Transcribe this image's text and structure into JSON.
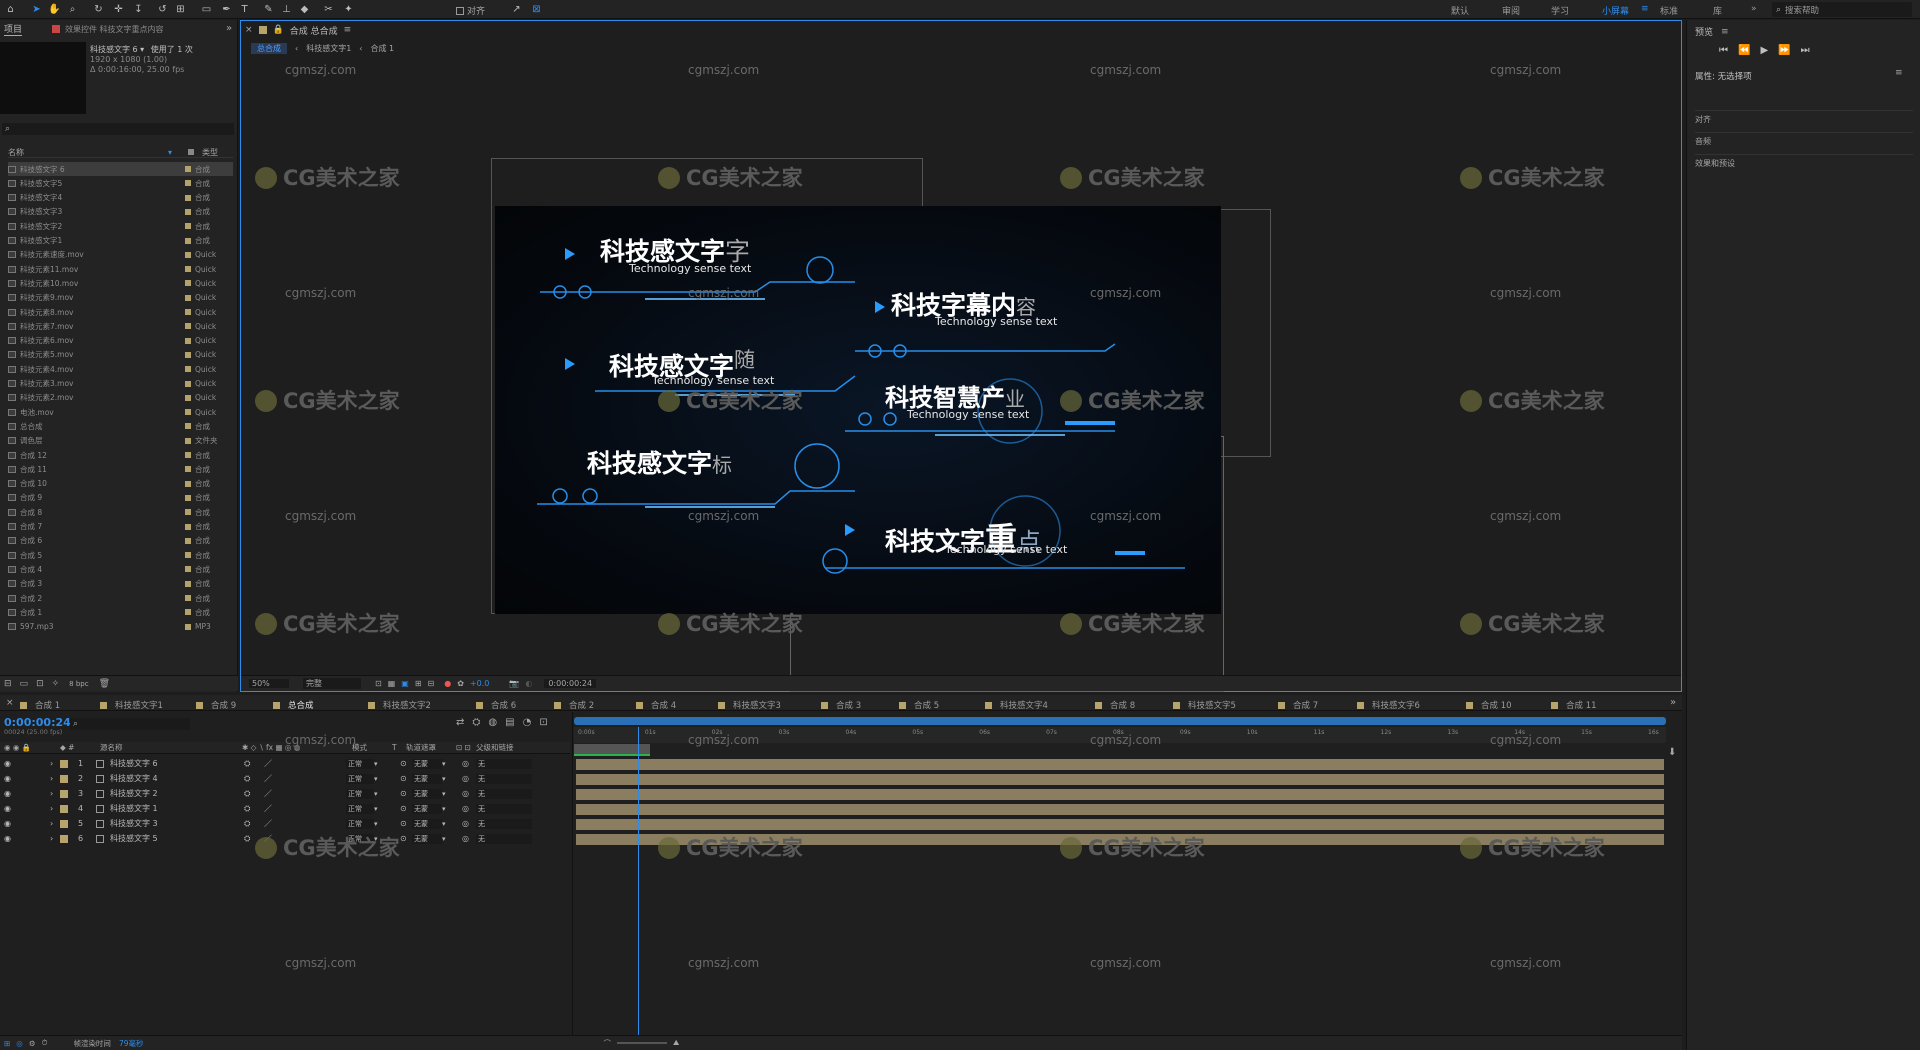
{
  "toolbar": {
    "align_label": "对齐",
    "workspaces": [
      "默认",
      "审阅",
      "学习",
      "小屏幕",
      "标准",
      "库"
    ],
    "search_placeholder": "搜索帮助",
    "active_color": "#2d8ceb"
  },
  "project": {
    "tab_label": "项目",
    "effect_tab": "效果控件 科技文字重点内容",
    "selected_name": "科技感文字 6 ▾",
    "selected_usage": "使用了 1 次",
    "selected_info1": "1920 x 1080 (1.00)",
    "selected_info2": "Δ 0:00:16:00, 25.00 fps",
    "col_name": "名称",
    "col_type": "类型",
    "items": [
      {
        "name": "科技感文字 6",
        "type": "合成"
      },
      {
        "name": "科技感文字5",
        "type": "合成"
      },
      {
        "name": "科技感文字4",
        "type": "合成"
      },
      {
        "name": "科技感文字3",
        "type": "合成"
      },
      {
        "name": "科技感文字2",
        "type": "合成"
      },
      {
        "name": "科技感文字1",
        "type": "合成"
      },
      {
        "name": "科技元素速度.mov",
        "type": "Quick"
      },
      {
        "name": "科技元素11.mov",
        "type": "Quick"
      },
      {
        "name": "科技元素10.mov",
        "type": "Quick"
      },
      {
        "name": "科技元素9.mov",
        "type": "Quick"
      },
      {
        "name": "科技元素8.mov",
        "type": "Quick"
      },
      {
        "name": "科技元素7.mov",
        "type": "Quick"
      },
      {
        "name": "科技元素6.mov",
        "type": "Quick"
      },
      {
        "name": "科技元素5.mov",
        "type": "Quick"
      },
      {
        "name": "科技元素4.mov",
        "type": "Quick"
      },
      {
        "name": "科技元素3.mov",
        "type": "Quick"
      },
      {
        "name": "科技元素2.mov",
        "type": "Quick"
      },
      {
        "name": "电池.mov",
        "type": "Quick"
      },
      {
        "name": "总合成",
        "type": "合成"
      },
      {
        "name": "调色层",
        "type": "文件夹"
      },
      {
        "name": "合成 12",
        "type": "合成"
      },
      {
        "name": "合成 11",
        "type": "合成"
      },
      {
        "name": "合成 10",
        "type": "合成"
      },
      {
        "name": "合成 9",
        "type": "合成"
      },
      {
        "name": "合成 8",
        "type": "合成"
      },
      {
        "name": "合成 7",
        "type": "合成"
      },
      {
        "name": "合成 6",
        "type": "合成"
      },
      {
        "name": "合成 5",
        "type": "合成"
      },
      {
        "name": "合成 4",
        "type": "合成"
      },
      {
        "name": "合成 3",
        "type": "合成"
      },
      {
        "name": "合成 2",
        "type": "合成"
      },
      {
        "name": "合成 1",
        "type": "合成"
      },
      {
        "name": "597.mp3",
        "type": "MP3"
      }
    ],
    "bpc": "8 bpc"
  },
  "viewer": {
    "tab_label": "合成 总合成",
    "breadcrumbs": [
      "总合成",
      "科技感文字1",
      "合成 1"
    ],
    "zoom": "50%",
    "quality": "完整",
    "exposure": "+0.0",
    "timecode": "0:00:00:24"
  },
  "canvas": {
    "captions": [
      {
        "main": "科技感文字",
        "extra": "字",
        "sub": "Technology sense text"
      },
      {
        "main": "科技字幕内",
        "extra": "容",
        "sub": "Technology sense text"
      },
      {
        "main": "科技感文字",
        "extra": "随",
        "sub": "Technology sense text"
      },
      {
        "main": "科技智慧产",
        "extra": "业",
        "sub": "Technology sense text"
      },
      {
        "main": "科技感文字",
        "extra": "标",
        "sub": ""
      },
      {
        "main": "科技文字",
        "extra": "重",
        "extra2": "点",
        "sub": "Technology sense text"
      }
    ],
    "glow_color": "#2b9cff"
  },
  "watermarks": {
    "url": "cgmszj.com",
    "brand": "CG美术之家"
  },
  "right_panel": {
    "preview": "预览",
    "properties": "属性: 无选择项",
    "sections": [
      "对齐",
      "音频",
      "效果和预设"
    ]
  },
  "timeline": {
    "tabs": [
      "合成 1",
      "科技感文字1",
      "合成 9",
      "总合成",
      "科技感文字2",
      "合成 6",
      "合成 2",
      "合成 4",
      "科技感文字3",
      "合成 3",
      "合成 5",
      "科技感文字4",
      "合成 8",
      "科技感文字5",
      "合成 7",
      "科技感文字6",
      "合成 10",
      "合成 11"
    ],
    "current_time": "0:00:00:24",
    "frames_info": "00024 (25.00 fps)",
    "col_source": "源名称",
    "col_mode": "模式",
    "col_t": "T",
    "col_track": "轨道遮罩",
    "col_parent": "父级和链接",
    "ruler": [
      "0:00s",
      "01s",
      "02s",
      "03s",
      "04s",
      "05s",
      "06s",
      "07s",
      "08s",
      "09s",
      "10s",
      "11s",
      "12s",
      "13s",
      "14s",
      "15s",
      "16s"
    ],
    "layers": [
      {
        "num": "1",
        "name": "科技感文字 6",
        "mode": "正常",
        "track": "无蒙",
        "parent": "无"
      },
      {
        "num": "2",
        "name": "科技感文字 4",
        "mode": "正常",
        "track": "无蒙",
        "parent": "无"
      },
      {
        "num": "3",
        "name": "科技感文字 2",
        "mode": "正常",
        "track": "无蒙",
        "parent": "无"
      },
      {
        "num": "4",
        "name": "科技感文字 1",
        "mode": "正常",
        "track": "无蒙",
        "parent": "无"
      },
      {
        "num": "5",
        "name": "科技感文字 3",
        "mode": "正常",
        "track": "无蒙",
        "parent": "无"
      },
      {
        "num": "6",
        "name": "科技感文字 5",
        "mode": "正常",
        "track": "无蒙",
        "parent": "无"
      }
    ],
    "render_label": "帧渲染时间",
    "render_value": "79毫秒",
    "playhead_fraction": 0.06
  }
}
